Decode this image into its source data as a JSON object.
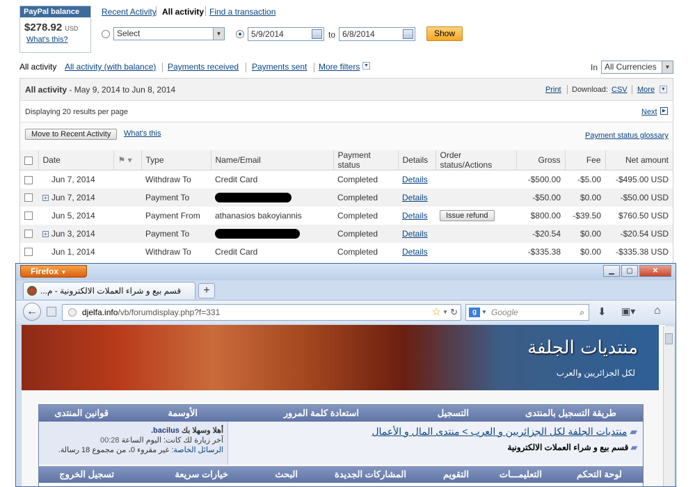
{
  "balance": {
    "title": "PayPal balance",
    "amount": "$278.92",
    "currency": "USD",
    "whats_this": "What's this?"
  },
  "tabs": {
    "recent": "Recent Activity",
    "all": "All activity",
    "find": "Find a transaction"
  },
  "filter": {
    "select_value": "Select",
    "from": "5/9/2014",
    "to_label": "to",
    "to": "6/8/2014",
    "show": "Show"
  },
  "activity_nav": {
    "current": "All activity",
    "with_balance": "All activity (with balance)",
    "received": "Payments received",
    "sent": "Payments sent",
    "more_filters": "More filters",
    "in_label": "In",
    "currency": "All Currencies"
  },
  "panel": {
    "title": "All activity",
    "range": " - May 9, 2014 to Jun 8, 2014",
    "print": "Print",
    "download_label": "Download:",
    "csv": "CSV",
    "more": "More",
    "displaying": "Displaying 20 results per page",
    "next": "Next",
    "move_btn": "Move to Recent Activity",
    "whats_this": "What's this",
    "glossary": "Payment status glossary"
  },
  "columns": {
    "date": "Date",
    "type": "Type",
    "name": "Name/Email",
    "status": "Payment status",
    "details": "Details",
    "order": "Order status/Actions",
    "gross": "Gross",
    "fee": "Fee",
    "net": "Net amount"
  },
  "rows": [
    {
      "date": "Jun 7, 2014",
      "type": "Withdraw To",
      "name": "Credit Card",
      "status": "Completed",
      "details": "Details",
      "action": "",
      "gross": "-$500.00",
      "fee": "-$5.00",
      "net": "-$495.00 USD"
    },
    {
      "date": "Jun 7, 2014",
      "type": "Payment To",
      "name": "",
      "status": "Completed",
      "details": "Details",
      "action": "",
      "gross": "-$50.00",
      "fee": "$0.00",
      "net": "-$50.00 USD"
    },
    {
      "date": "Jun 5, 2014",
      "type": "Payment From",
      "name": "athanasios bakoyiannis",
      "status": "Completed",
      "details": "Details",
      "action": "Issue refund",
      "gross": "$800.00",
      "fee": "-$39.50",
      "net": "$760.50 USD"
    },
    {
      "date": "Jun 3, 2014",
      "type": "Payment To",
      "name": "",
      "status": "Completed",
      "details": "Details",
      "action": "",
      "gross": "-$20.54",
      "fee": "$0.00",
      "net": "-$20.54 USD"
    },
    {
      "date": "Jun 1, 2014",
      "type": "Withdraw To",
      "name": "Credit Card",
      "status": "Completed",
      "details": "Details",
      "action": "",
      "gross": "-$335.38",
      "fee": "$0.00",
      "net": "-$335.38 USD"
    }
  ],
  "firefox": {
    "menu": "Firefox",
    "tab_title": "قسم بيع و شراء العملات الالكترونية - م...",
    "url_domain": "djelfa.info",
    "url_path": "/vb/forumdisplay.php?f=331",
    "search_placeholder": "Google",
    "banner_logo": "منتديات الجلفة",
    "banner_sub": "لكل الجزائريين والعرب"
  },
  "forum": {
    "nav1": [
      "طريقة التسجيل بالمنتدى",
      "التسجيل",
      "استعادة كلمة المرور",
      "الأوسمة",
      "قوانين المنتدى"
    ],
    "breadcrumb": "منتديات الجلفة لكل الجزائريين و العرب > منتدى المال و الأعمال",
    "section": "قسم بيع و شراء العملات الالكترونية",
    "welcome": "أهلا وسهلا بك",
    "username": "bacilus.",
    "last_visit": "آخر زيارة لك كانت: اليوم الساعة",
    "last_visit_time": "00:28",
    "pm": "الرسائل الخاصة:",
    "pm_count": "غير مقروء 0، من مجموع 18 رسالة.",
    "nav2": [
      "لوحة التحكم",
      "التعليمـــات",
      "التقويم",
      "المشاركات الجديدة",
      "البحث",
      "خيارات سريعة",
      "تسجيل الخروج"
    ]
  }
}
